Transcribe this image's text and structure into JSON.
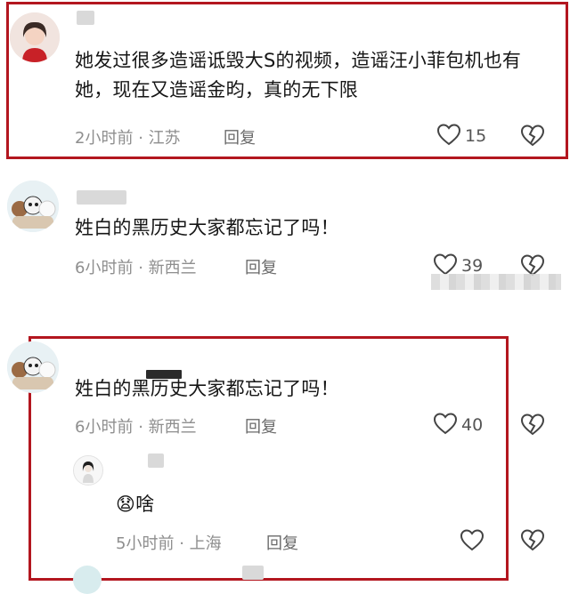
{
  "comments": [
    {
      "text": "她发过很多造谣诋毁大S的视频，造谣汪小菲包机也有她，现在又造谣金昀，真的无下限",
      "time": "2小时前",
      "location": "江苏",
      "reply_label": "回复",
      "likes": "15"
    },
    {
      "text": "姓白的黑历史大家都忘记了吗！",
      "time": "6小时前",
      "location": "新西兰",
      "reply_label": "回复",
      "likes": "39"
    },
    {
      "text": "姓白的黑历史大家都忘记了吗！",
      "time": "6小时前",
      "location": "新西兰",
      "reply_label": "回复",
      "likes": "40",
      "replies": [
        {
          "emoji": "😧",
          "text": "啥",
          "time": "5小时前",
          "location": "上海",
          "reply_label": "回复"
        }
      ]
    }
  ],
  "separator": "·",
  "colors": {
    "highlight_border": "#b3161f",
    "meta_text": "#8e8e8e"
  },
  "icons": {
    "like": "heart-outline-icon",
    "dislike": "broken-heart-icon"
  }
}
